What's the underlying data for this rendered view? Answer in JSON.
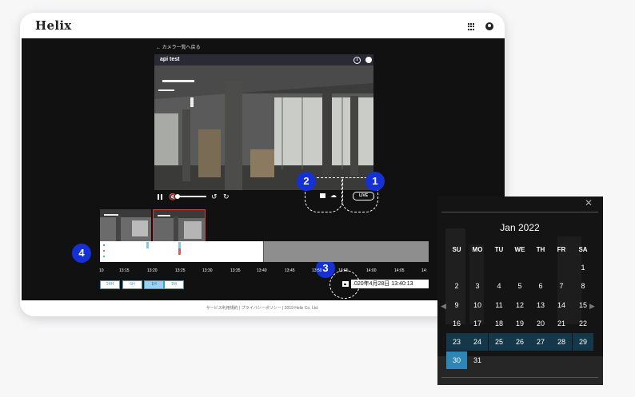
{
  "app": {
    "logo": "Helix"
  },
  "camera": {
    "back_label": "← カメラ一覧へ戻る",
    "title": "api test",
    "live_label": "LIVE"
  },
  "steps": [
    "1",
    "2",
    "3",
    "4"
  ],
  "timeline": {
    "ticks": [
      "10",
      "13:15",
      "13:20",
      "13:25",
      "13:30",
      "13:35",
      "13:40",
      "13:45",
      "13:50",
      "13:55",
      "14:00",
      "14:05",
      "14:"
    ],
    "zoom_buttons": [
      {
        "label": "24H",
        "active": false
      },
      {
        "label": "6H",
        "active": false
      },
      {
        "label": "1H",
        "active": true
      },
      {
        "label": "1M",
        "active": false
      }
    ],
    "date_value": ".020年4月28日 13:40:13"
  },
  "footer": {
    "terms": "サービス利用規約",
    "privacy": "プライバシーポリシー",
    "copyright": "2019 Helix Co. Ltd."
  },
  "calendar": {
    "close": "✕",
    "month_label": "Jan 2022",
    "weekdays": [
      "SU",
      "MO",
      "TU",
      "WE",
      "TH",
      "FR",
      "SA"
    ],
    "weeks": [
      [
        "",
        "",
        "",
        "",
        "",
        "",
        "1"
      ],
      [
        "2",
        "3",
        "4",
        "5",
        "6",
        "7",
        "8"
      ],
      [
        "9",
        "10",
        "11",
        "12",
        "13",
        "14",
        "15"
      ],
      [
        "16",
        "17",
        "18",
        "19",
        "20",
        "21",
        "22"
      ],
      [
        "23",
        "24",
        "25",
        "26",
        "27",
        "28",
        "29"
      ],
      [
        "30",
        "31",
        "",
        "",
        "",
        "",
        ""
      ]
    ],
    "range_row": 4,
    "selected_day": "30"
  },
  "colors": {
    "accent": "#1531d6",
    "calendar_selected": "#2e86b5",
    "calendar_range": "#15374a"
  }
}
